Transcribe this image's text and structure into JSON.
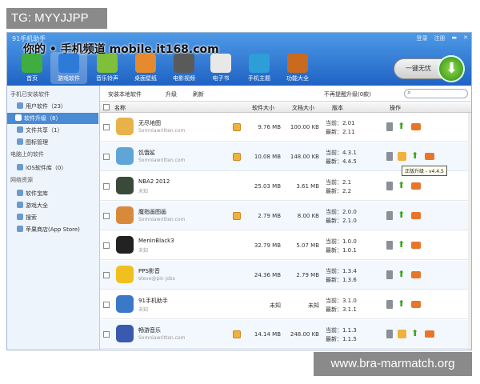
{
  "watermarks": {
    "top": "TG: MYYJJPP",
    "bottom": "www.bra-marmatch.org"
  },
  "app": {
    "title": "91手机助手",
    "overlay": "你的 • 手机频道 mobile.it168.com",
    "window_controls": [
      "登录",
      "注册"
    ],
    "one_key_button": "一键无忧"
  },
  "toolbar": [
    {
      "label": "首页",
      "color": "#3fae3f"
    },
    {
      "label": "游戏软件",
      "color": "#2c7bd8"
    },
    {
      "label": "音乐铃声",
      "color": "#7fbf3a"
    },
    {
      "label": "桌面壁纸",
      "color": "#e58a2f"
    },
    {
      "label": "电影视频",
      "color": "#5a5a5a"
    },
    {
      "label": "电子书",
      "color": "#e8e8e8"
    },
    {
      "label": "手机主题",
      "color": "#2d9fd6"
    },
    {
      "label": "功能大全",
      "color": "#c96a1f"
    }
  ],
  "sidebar": {
    "items": [
      {
        "text": "手机已安装软件",
        "type": "head"
      },
      {
        "text": "用户软件（23）",
        "type": "item"
      },
      {
        "text": "软件升级（8）",
        "type": "sel"
      },
      {
        "text": "文件共享（1）",
        "type": "item"
      },
      {
        "text": "图标管理",
        "type": "item"
      },
      {
        "text": "电脑上的软件",
        "type": "head"
      },
      {
        "text": "iOS软件库（0）",
        "type": "item"
      },
      {
        "text": "网络资源",
        "type": "head"
      },
      {
        "text": "软件宝库",
        "type": "item"
      },
      {
        "text": "游戏大全",
        "type": "item"
      },
      {
        "text": "搜索",
        "type": "item"
      },
      {
        "text": "苹果商店(App Store)",
        "type": "item"
      }
    ]
  },
  "subbar": {
    "install_local": "安装本地软件",
    "upgrade": "升级",
    "refresh": "刷新",
    "ignored": "不再提醒升级(0款)"
  },
  "table": {
    "headers": {
      "name": "名称",
      "size": "软件大小",
      "dsize": "文档大小",
      "version": "版本",
      "action": "操作"
    },
    "rows": [
      {
        "name": "无尽地图",
        "dev": "Somniawritten.com",
        "flag": true,
        "size": "9.76 MB",
        "dsize": "100.00 KB",
        "current": "当前：2.01",
        "latest": "最新：2.11",
        "icon": "#e8b24a",
        "upbox": false
      },
      {
        "name": "饥饿鲨",
        "dev": "Somniawritten.com",
        "flag": true,
        "size": "10.08 MB",
        "dsize": "148.00 KB",
        "current": "当前：4.3.1",
        "latest": "最新：4.4.5",
        "icon": "#5fa5d8",
        "upbox": true
      },
      {
        "name": "NBA2 2012",
        "dev": "未知",
        "flag": false,
        "size": "25.03 MB",
        "dsize": "3.61 MB",
        "current": "当前：2.1",
        "latest": "最新：2.2",
        "icon": "#3a4a3a",
        "upbox": false
      },
      {
        "name": "魔指画图画",
        "dev": "Somniawritten.com",
        "flag": true,
        "size": "2.79 MB",
        "dsize": "8.00 KB",
        "current": "当前：2.0.0",
        "latest": "最新：2.1.0",
        "icon": "#d88a3a",
        "upbox": false
      },
      {
        "name": "MenInBlack3",
        "dev": "未知",
        "flag": false,
        "size": "32.79 MB",
        "dsize": "5.07 MB",
        "current": "当前：1.0.0",
        "latest": "最新：1.0.1",
        "icon": "#222222",
        "upbox": false
      },
      {
        "name": "PPS影音",
        "dev": "steve@pin jobs",
        "flag": false,
        "size": "24.36 MB",
        "dsize": "2.79 MB",
        "current": "当前：1.3.4",
        "latest": "最新：1.3.6",
        "icon": "#f0c020",
        "upbox": false
      },
      {
        "name": "91手机助手",
        "dev": "未知",
        "flag": false,
        "size": "未知",
        "dsize": "未知",
        "current": "当前：3.1.0",
        "latest": "最新：3.1.1",
        "icon": "#3a78c8",
        "upbox": false
      },
      {
        "name": "畅游音乐",
        "dev": "Somniawritten.com",
        "flag": true,
        "size": "14.14 MB",
        "dsize": "248.00 KB",
        "current": "当前：1.1.3",
        "latest": "最新：1.1.5",
        "icon": "#3a5ab0",
        "upbox": true
      }
    ]
  },
  "tooltip": "正版升级 - v4.4.5"
}
